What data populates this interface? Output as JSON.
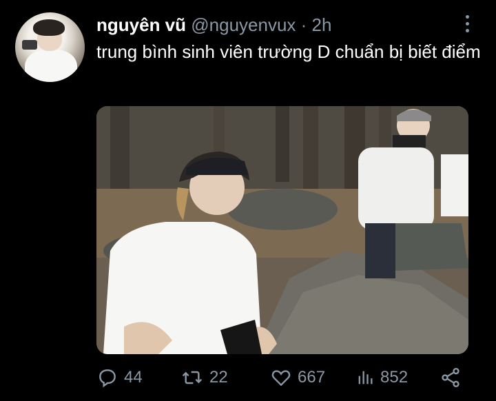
{
  "tweet": {
    "display_name": "nguyên vũ",
    "handle": "@nguyenvux",
    "separator": "·",
    "time": "2h",
    "text": "trung bình sinh viên trường D chuẩn bị biết điểm"
  },
  "actions": {
    "replies": "44",
    "retweets": "22",
    "likes": "667",
    "views": "852"
  },
  "icons": [
    "more-icon",
    "reply-icon",
    "retweet-icon",
    "like-icon",
    "views-icon",
    "share-icon"
  ],
  "colors": {
    "background": "#000000",
    "text": "#e7e9ea",
    "muted": "#8b98a5"
  }
}
